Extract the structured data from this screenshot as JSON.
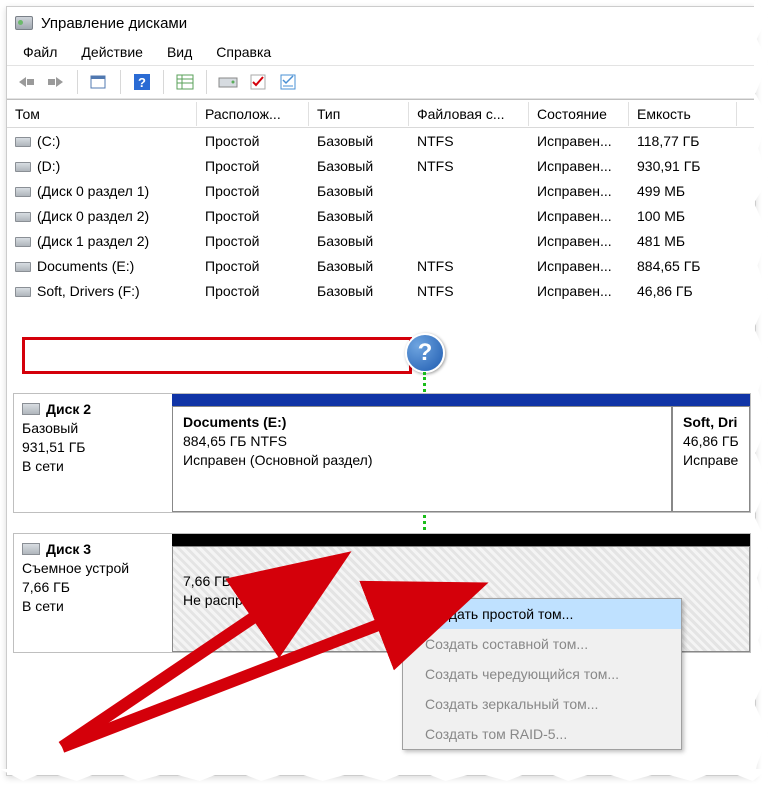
{
  "window": {
    "title": "Управление дисками"
  },
  "menu": {
    "file": "Файл",
    "action": "Действие",
    "view": "Вид",
    "help": "Справка"
  },
  "columns": {
    "c0": "Том",
    "c1": "Располож...",
    "c2": "Тип",
    "c3": "Файловая с...",
    "c4": "Состояние",
    "c5": "Емкость"
  },
  "rows": [
    {
      "vol": "(C:)",
      "lay": "Простой",
      "type": "Базовый",
      "fs": "NTFS",
      "st": "Исправен...",
      "cap": "118,77 ГБ"
    },
    {
      "vol": "(D:)",
      "lay": "Простой",
      "type": "Базовый",
      "fs": "NTFS",
      "st": "Исправен...",
      "cap": "930,91 ГБ"
    },
    {
      "vol": "(Диск 0 раздел 1)",
      "lay": "Простой",
      "type": "Базовый",
      "fs": "",
      "st": "Исправен...",
      "cap": "499 МБ"
    },
    {
      "vol": "(Диск 0 раздел 2)",
      "lay": "Простой",
      "type": "Базовый",
      "fs": "",
      "st": "Исправен...",
      "cap": "100 МБ"
    },
    {
      "vol": "(Диск 1 раздел 2)",
      "lay": "Простой",
      "type": "Базовый",
      "fs": "",
      "st": "Исправен...",
      "cap": "481 МБ"
    },
    {
      "vol": "Documents (E:)",
      "lay": "Простой",
      "type": "Базовый",
      "fs": "NTFS",
      "st": "Исправен...",
      "cap": "884,65 ГБ"
    },
    {
      "vol": "Soft, Drivers (F:)",
      "lay": "Простой",
      "type": "Базовый",
      "fs": "NTFS",
      "st": "Исправен...",
      "cap": "46,86 ГБ"
    }
  ],
  "disk2": {
    "name": "Диск 2",
    "type": "Базовый",
    "size": "931,51 ГБ",
    "status": "В сети",
    "p1": {
      "title": "Documents  (E:)",
      "line2": "884,65 ГБ NTFS",
      "line3": "Исправен (Основной раздел)"
    },
    "p2": {
      "title": "Soft, Dri",
      "line2": "46,86 ГБ",
      "line3": "Исправе"
    }
  },
  "disk3": {
    "name": "Диск 3",
    "type": "Съемное устрой",
    "size": "7,66 ГБ",
    "status": "В сети",
    "p1": {
      "line1": "",
      "line2": "7,66 ГБ",
      "line3": "Не распределена"
    }
  },
  "ctx": {
    "i0": "Создать простой том...",
    "i1": "Создать составной том...",
    "i2": "Создать чередующийся том...",
    "i3": "Создать зеркальный том...",
    "i4": "Создать том RAID-5..."
  },
  "help_badge": "?"
}
